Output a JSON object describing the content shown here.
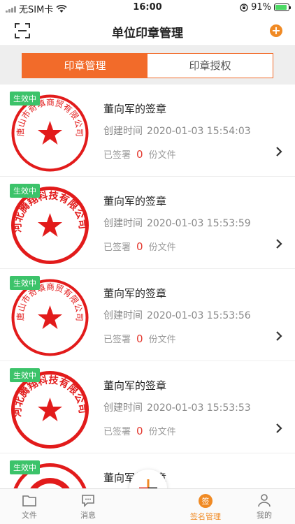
{
  "status": {
    "carrier": "无SIM卡",
    "time": "16:00",
    "battery": "91%"
  },
  "header": {
    "title": "单位印章管理"
  },
  "segments": [
    {
      "label": "印章管理",
      "active": true
    },
    {
      "label": "印章授权",
      "active": false
    }
  ],
  "seals": [
    {
      "badge": "生效中",
      "name": "董向军的签章",
      "created_label": "创建时间",
      "created_time": "2020-01-03 15:54:03",
      "signed_prefix": "已签署",
      "signed_count": "0",
      "signed_suffix": "份文件",
      "seal_text": "唐山市奇填商贸有限公司"
    },
    {
      "badge": "生效中",
      "name": "董向军的签章",
      "created_label": "创建时间",
      "created_time": "2020-01-03 15:53:59",
      "signed_prefix": "已签署",
      "signed_count": "0",
      "signed_suffix": "份文件",
      "seal_text": "河北腾翔科技有限公司"
    },
    {
      "badge": "生效中",
      "name": "董向军的签章",
      "created_label": "创建时间",
      "created_time": "2020-01-03 15:53:56",
      "signed_prefix": "已签署",
      "signed_count": "0",
      "signed_suffix": "份文件",
      "seal_text": "唐山市奇填商贸有限公司"
    },
    {
      "badge": "生效中",
      "name": "董向军的签章",
      "created_label": "创建时间",
      "created_time": "2020-01-03 15:53:53",
      "signed_prefix": "已签署",
      "signed_count": "0",
      "signed_suffix": "份文件",
      "seal_text": "河北腾翔科技有限公司"
    },
    {
      "badge": "生效中",
      "name": "董向军的签章",
      "created_label": "",
      "created_time": "",
      "signed_prefix": "",
      "signed_count": "",
      "signed_suffix": "",
      "seal_text": ""
    }
  ],
  "tabbar": [
    {
      "label": "文件",
      "icon": "folder-icon"
    },
    {
      "label": "消息",
      "icon": "message-icon"
    },
    {
      "label": "签名管理",
      "icon": "sign-icon",
      "active": true
    },
    {
      "label": "我的",
      "icon": "profile-icon"
    }
  ],
  "colors": {
    "accent": "#f26b2a",
    "badge": "#3cc36a",
    "seal_red": "#e21b1b"
  }
}
